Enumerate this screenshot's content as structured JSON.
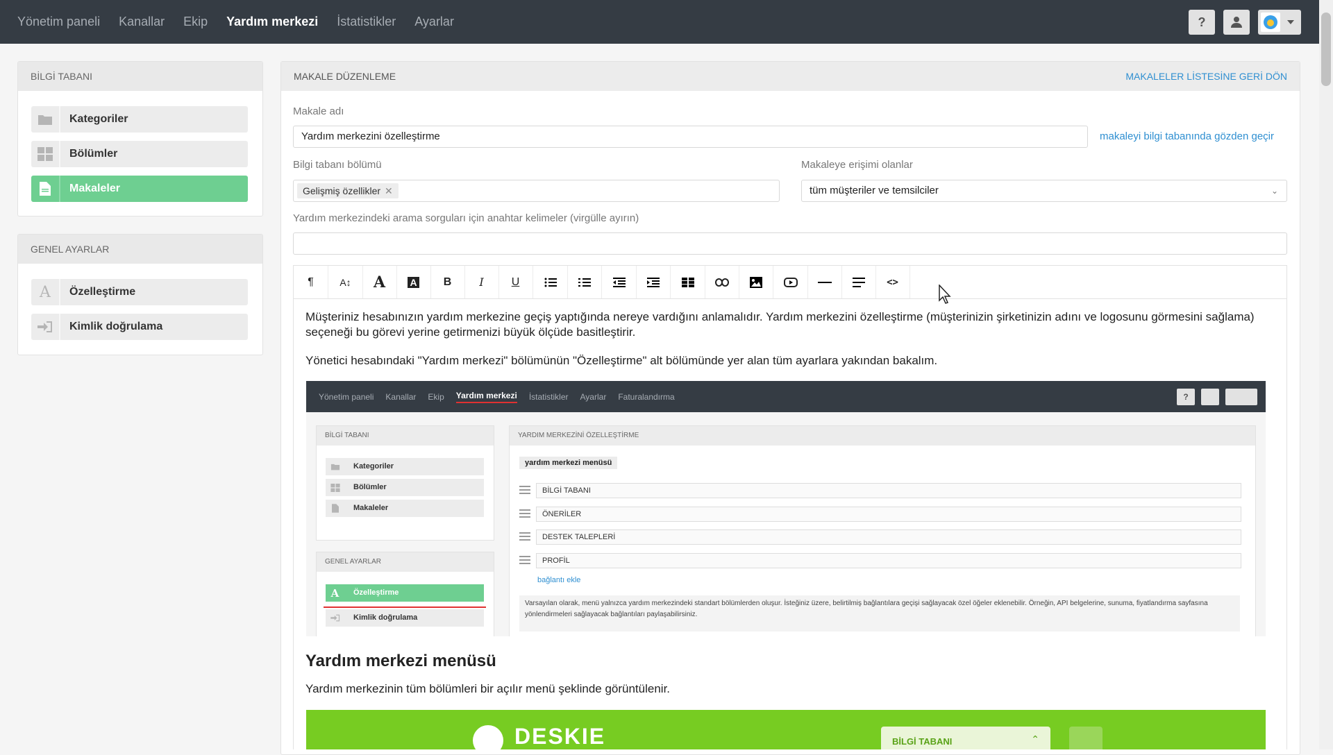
{
  "topnav": {
    "items": [
      "Yönetim paneli",
      "Kanallar",
      "Ekip",
      "Yardım merkezi",
      "İstatistikler",
      "Ayarlar"
    ],
    "active_index": 3
  },
  "sidebar": {
    "kb_title": "BİLGİ TABANI",
    "kb_items": [
      {
        "label": "Kategoriler",
        "icon": "folder-icon"
      },
      {
        "label": "Bölümler",
        "icon": "grid-icon"
      },
      {
        "label": "Makaleler",
        "icon": "document-icon",
        "active": true
      }
    ],
    "settings_title": "GENEL AYARLAR",
    "settings_items": [
      {
        "label": "Özelleştirme",
        "icon": "letter-a-icon"
      },
      {
        "label": "Kimlik doğrulama",
        "icon": "sign-in-icon"
      }
    ]
  },
  "main": {
    "title": "MAKALE DÜZENLEME",
    "back_link": "MAKALELER LİSTESİNE GERİ DÖN",
    "name_label": "Makale adı",
    "name_value": "Yardım merkezini özelleştirme",
    "preview_link": "makaleyi bilgi tabanında gözden geçir",
    "section_label": "Bilgi tabanı bölümü",
    "section_tag": "Gelişmiş özellikler",
    "access_label": "Makaleye erişimi olanlar",
    "access_value": "tüm müşteriler ve temsilciler",
    "keywords_label": "Yardım merkezindeki arama sorguları için anahtar kelimeler (virgülle ayırın)",
    "keywords_value": ""
  },
  "toolbar": {
    "buttons": [
      "paragraph",
      "font-size",
      "font-color",
      "highlight",
      "bold",
      "italic",
      "underline",
      "bulleted-list",
      "numbered-list",
      "outdent",
      "indent",
      "table",
      "link",
      "image",
      "video",
      "horizontal-rule",
      "align",
      "code"
    ]
  },
  "editor": {
    "p1": "Müşteriniz hesabınızın yardım merkezine geçiş yaptığında nereye vardığını anlamalıdır. Yardım merkezini özelleştirme (müşterinizin şirketinizin adını ve logosunu görmesini sağlama) seçeneği bu görevi yerine getirmenizi büyük ölçüde basitleştirir.",
    "p2": "Yönetici hesabındaki \"Yardım merkezi\" bölümünün \"Özelleştirme\" alt bölümünde yer alan tüm ayarlara yakından bakalım.",
    "h2": "Yardım merkezi menüsü",
    "p3": "Yardım merkezinin tüm bölümleri bir açılır menü şeklinde görüntülenir."
  },
  "embedded_shot": {
    "nav": [
      "Yönetim paneli",
      "Kanallar",
      "Ekip",
      "Yardım merkezi",
      "İstatistikler",
      "Ayarlar",
      "Faturalandırma"
    ],
    "kb_title": "BİLGİ TABANI",
    "kb_items": [
      "Kategoriler",
      "Bölümler",
      "Makaleler"
    ],
    "settings_title": "GENEL AYARLAR",
    "settings_items": [
      "Özelleştirme",
      "Kimlik doğrulama"
    ],
    "panel_title": "YARDIM MERKEZİNİ ÖZELLEŞTİRME",
    "menu_badge": "yardım merkezi menüsü",
    "menu_rows": [
      "BİLGİ TABANI",
      "ÖNERİLER",
      "DESTEK TALEPLERİ",
      "PROFİL"
    ],
    "add_link": "bağlantı ekle",
    "note": "Varsayılan olarak, menü yalnızca yardım merkezindeki standart bölümlerden oluşur. İsteğiniz üzere, belirtilmiş bağlantılara geçişi sağlayacak özel öğeler eklenebilir. Örneğin, API belgelerine, sunuma, fiyatlandırma sayfasına yönlendirmeleri sağlayacak bağlantıları paylaşabilirsiniz."
  },
  "banner": {
    "logo_text": "DESKIE",
    "dropdown_label": "BİLGİ TABANI"
  },
  "colors": {
    "topbar": "#353c44",
    "accent_green": "#6ecf91",
    "link_blue": "#2f8fd1",
    "banner_green": "#77cc22"
  }
}
